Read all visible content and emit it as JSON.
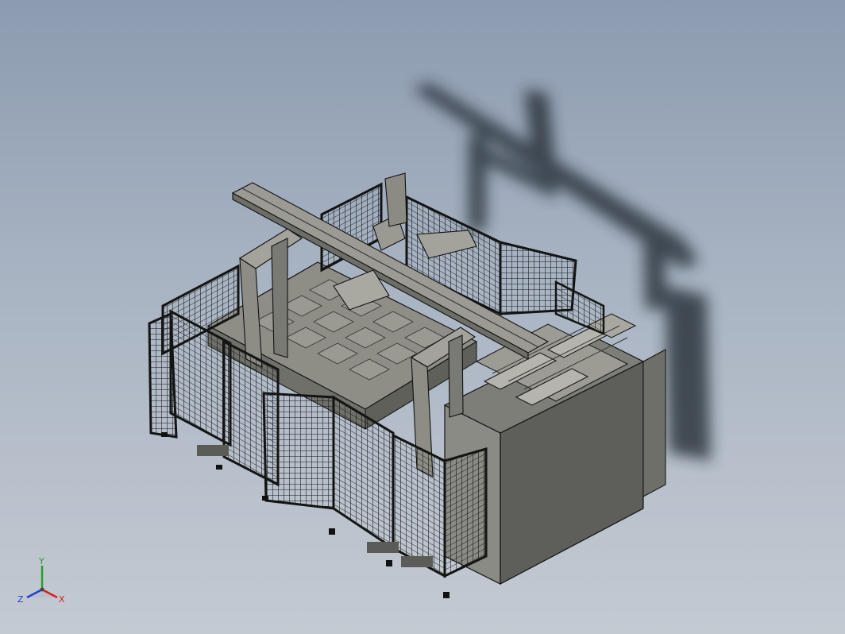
{
  "viewport": {
    "background_top": "#8c9bb0",
    "background_bottom": "#c4cad2",
    "model_color": "#8e8e86",
    "model_shadow_color": "#222a33",
    "fence_color": "#141414"
  },
  "triad": {
    "x_label": "X",
    "y_label": "Y",
    "z_label": "Z",
    "x_color": "#d62020",
    "y_color": "#2aa02a",
    "z_color": "#2040d0"
  }
}
